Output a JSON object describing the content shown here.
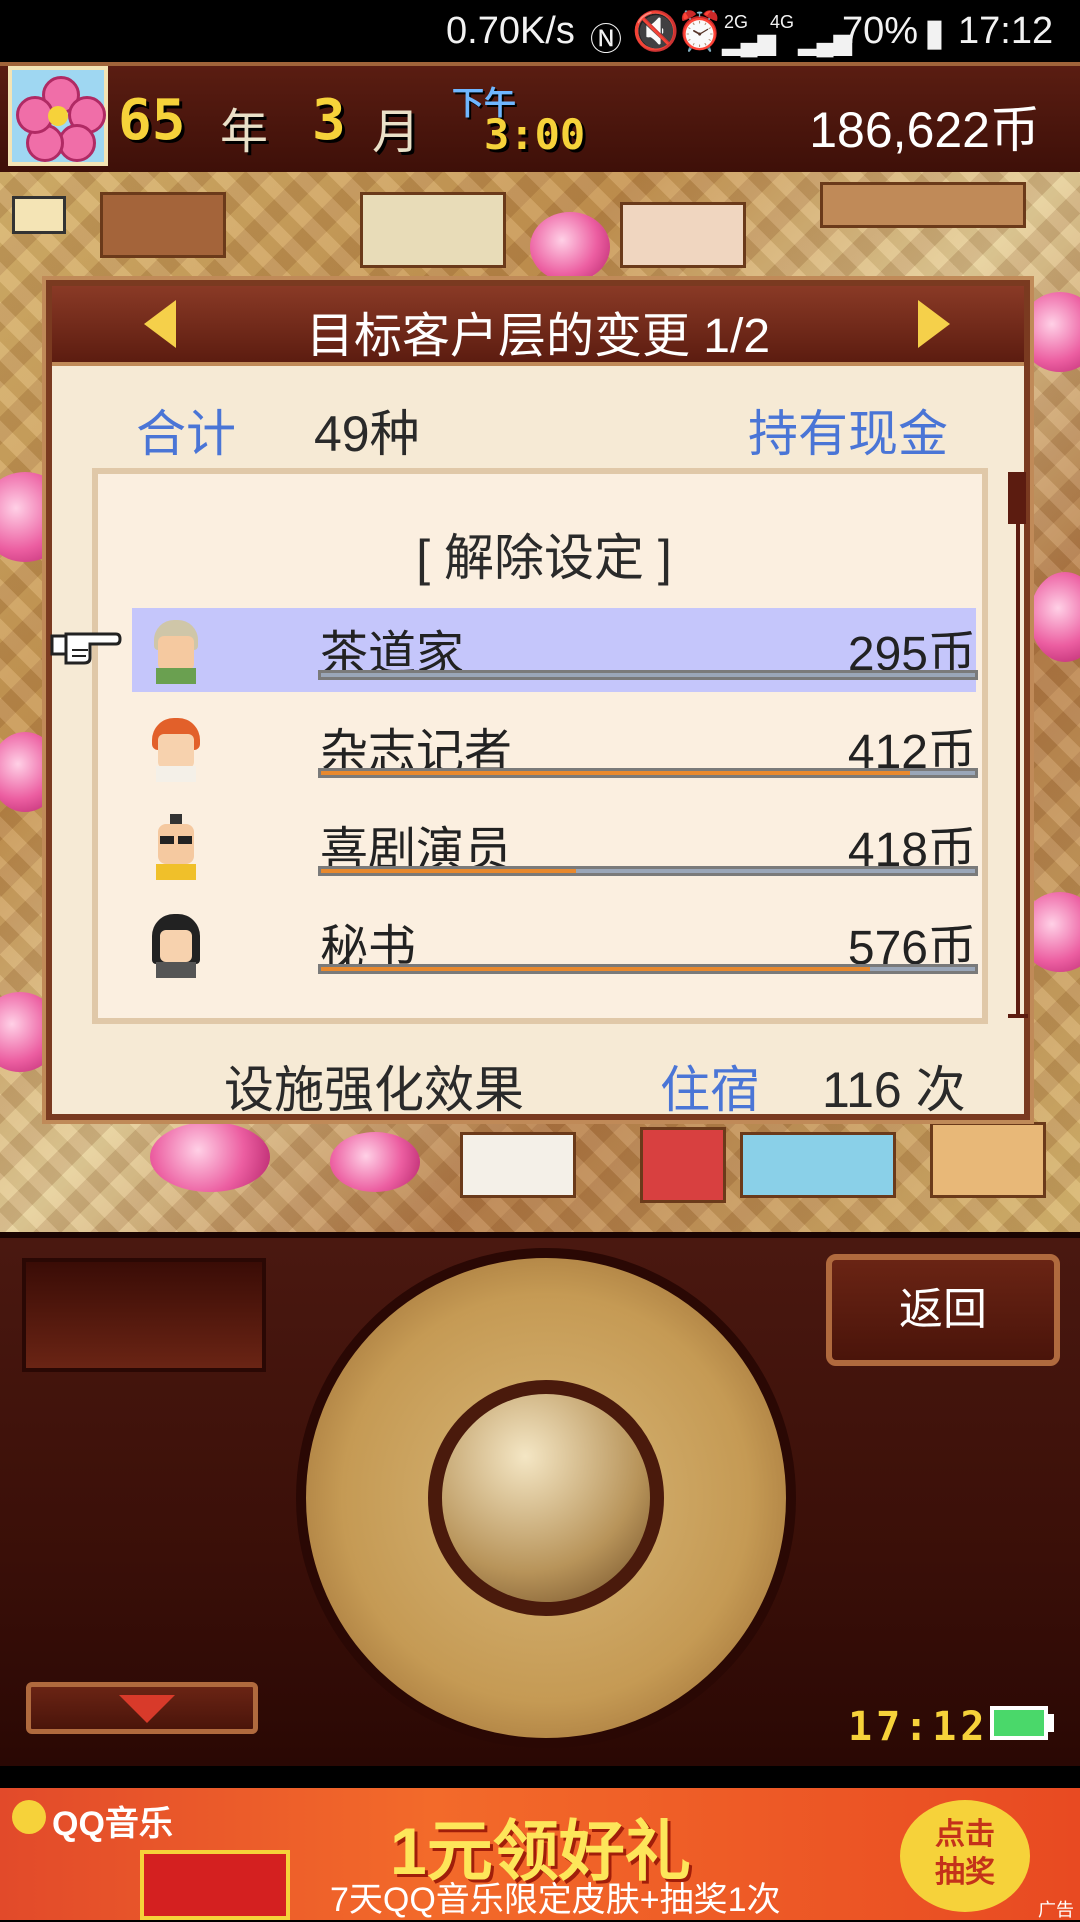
{
  "status_bar": {
    "net_speed": "0.70K/s",
    "signal_2g": "2G",
    "signal_4g": "4G",
    "battery": "70%",
    "time": "17:12"
  },
  "hud": {
    "year_value": "65",
    "year_unit": "年",
    "month_value": "3",
    "month_unit": "月",
    "period": "下午",
    "clock": "3:00",
    "coins": "186,622币"
  },
  "dialog": {
    "title": "目标客户层的变更 1/2",
    "total_label": "合计",
    "total_value": "49种",
    "cash_label": "持有现金",
    "clear_setting": "[  解除设定  ]",
    "rows": [
      {
        "name": "茶道家",
        "price": "295币",
        "progress": 1.0,
        "selected": true
      },
      {
        "name": "杂志记者",
        "price": "412币",
        "progress": 0.9,
        "selected": false
      },
      {
        "name": "喜剧演员",
        "price": "418币",
        "progress": 0.39,
        "selected": false
      },
      {
        "name": "秘书",
        "price": "576币",
        "progress": 0.84,
        "selected": false
      }
    ],
    "footer_label": "设施强化效果",
    "footer_category": "住宿",
    "footer_value": "116 次"
  },
  "controls": {
    "back_label": "返回",
    "clock": "17:12"
  },
  "ad": {
    "brand": "QQ音乐",
    "title": "1元领好礼",
    "subtitle": "7天QQ音乐限定皮肤+抽奖1次",
    "button": "点击\n抽奖",
    "tag": "广告"
  },
  "colors": {
    "accent_gold": "#f6d23a",
    "label_blue": "#4a75d6",
    "selected_row": "#c5c6fb",
    "progress_orange": "#e8892e"
  }
}
